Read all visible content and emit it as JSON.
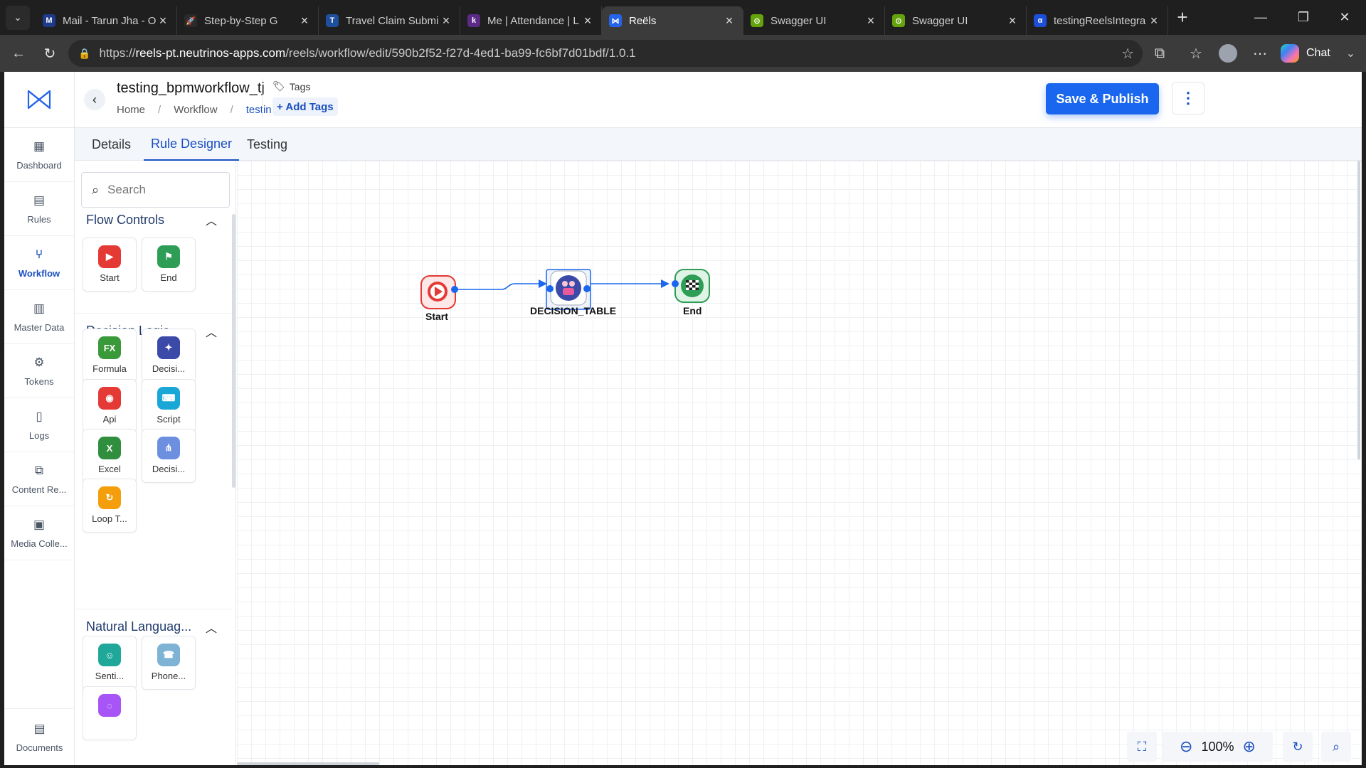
{
  "browser": {
    "tabs": [
      {
        "label": "Mail - Tarun Jha - O",
        "color": "#1e3a8a",
        "glyph": "M"
      },
      {
        "label": "Step-by-Step G",
        "color": "#2a2a2a",
        "glyph": "🚀"
      },
      {
        "label": "Travel Claim Submi",
        "color": "#1f4f9c",
        "glyph": "T"
      },
      {
        "label": "Me | Attendance | L",
        "color": "#5b2a86",
        "glyph": "k"
      },
      {
        "label": "Reëls",
        "color": "#2563eb",
        "glyph": "⋈"
      },
      {
        "label": "Swagger UI",
        "color": "#65a30d",
        "glyph": "⊙"
      },
      {
        "label": "Swagger UI",
        "color": "#65a30d",
        "glyph": "⊙"
      },
      {
        "label": "testingReelsIntegra",
        "color": "#1d4ed8",
        "glyph": "α"
      }
    ],
    "url_prefix": "https://",
    "url_host": "reels-pt.neutrinos-apps.com",
    "url_path": "/reels/workflow/edit/590b2f52-f27d-4ed1-ba99-fc6bf7d01bdf/1.0.1",
    "chat_label": "Chat"
  },
  "leftnav": [
    {
      "label": "Dashboard",
      "icon": "dashboard-icon",
      "glyph": "▦"
    },
    {
      "label": "Rules",
      "icon": "rules-icon",
      "glyph": "▤"
    },
    {
      "label": "Workflow",
      "icon": "workflow-icon",
      "glyph": "⑂",
      "active": true
    },
    {
      "label": "Master Data",
      "icon": "master-data-icon",
      "glyph": "▥"
    },
    {
      "label": "Tokens",
      "icon": "tokens-icon",
      "glyph": "⚙"
    },
    {
      "label": "Logs",
      "icon": "logs-icon",
      "glyph": "▯"
    },
    {
      "label": "Content Re...",
      "icon": "content-repo-icon",
      "glyph": "⧉"
    },
    {
      "label": "Media Colle...",
      "icon": "media-icon",
      "glyph": "▣"
    }
  ],
  "documents_label": "Documents",
  "header": {
    "title": "testing_bpmworkflow_tj",
    "breadcrumb": [
      "Home",
      "Workflow",
      "testin..."
    ],
    "tags_label": "Tags",
    "add_tags_label": "+ Add Tags",
    "publish_label": "Save & Publish",
    "kebab": "⋮"
  },
  "page_tabs": [
    {
      "label": "Details",
      "active": false
    },
    {
      "label": "Rule Designer",
      "active": true
    },
    {
      "label": "Testing",
      "active": false
    }
  ],
  "palette": {
    "search_placeholder": "Search",
    "sections": [
      {
        "title": "Flow Controls",
        "items": [
          {
            "label": "Start",
            "color": "#e53935",
            "glyph": "▶"
          },
          {
            "label": "End",
            "color": "#2e9d56",
            "glyph": "⚑"
          }
        ]
      },
      {
        "title": "Decision Logic",
        "items": [
          {
            "label": "Formula",
            "color": "#3a9a3a",
            "glyph": "FX"
          },
          {
            "label": "Decisi...",
            "color": "#3b4aa8",
            "glyph": "✦"
          },
          {
            "label": "Api",
            "color": "#e53935",
            "glyph": "◉"
          },
          {
            "label": "Script",
            "color": "#18a7d6",
            "glyph": "⌨"
          },
          {
            "label": "Excel",
            "color": "#2f8f3e",
            "glyph": "X"
          },
          {
            "label": "Decisi...",
            "color": "#6d8fe0",
            "glyph": "⋔"
          },
          {
            "label": "Loop T...",
            "color": "#f59e0b",
            "glyph": "↻"
          }
        ]
      },
      {
        "title": "Natural Languag...",
        "items": [
          {
            "label": "Senti...",
            "color": "#1fa89a",
            "glyph": "☺"
          },
          {
            "label": "Phone...",
            "color": "#7fb3d5",
            "glyph": "☎"
          },
          {
            "label": "",
            "color": "#a855f7",
            "glyph": "◌"
          }
        ]
      }
    ]
  },
  "workflow_nodes": {
    "start": "Start",
    "decision": "DECISION_TABLE",
    "end": "End"
  },
  "canvas_controls": {
    "zoom": "100%"
  },
  "colors": {
    "accent": "#1a66ee",
    "nav_active": "#1a4fc0"
  }
}
